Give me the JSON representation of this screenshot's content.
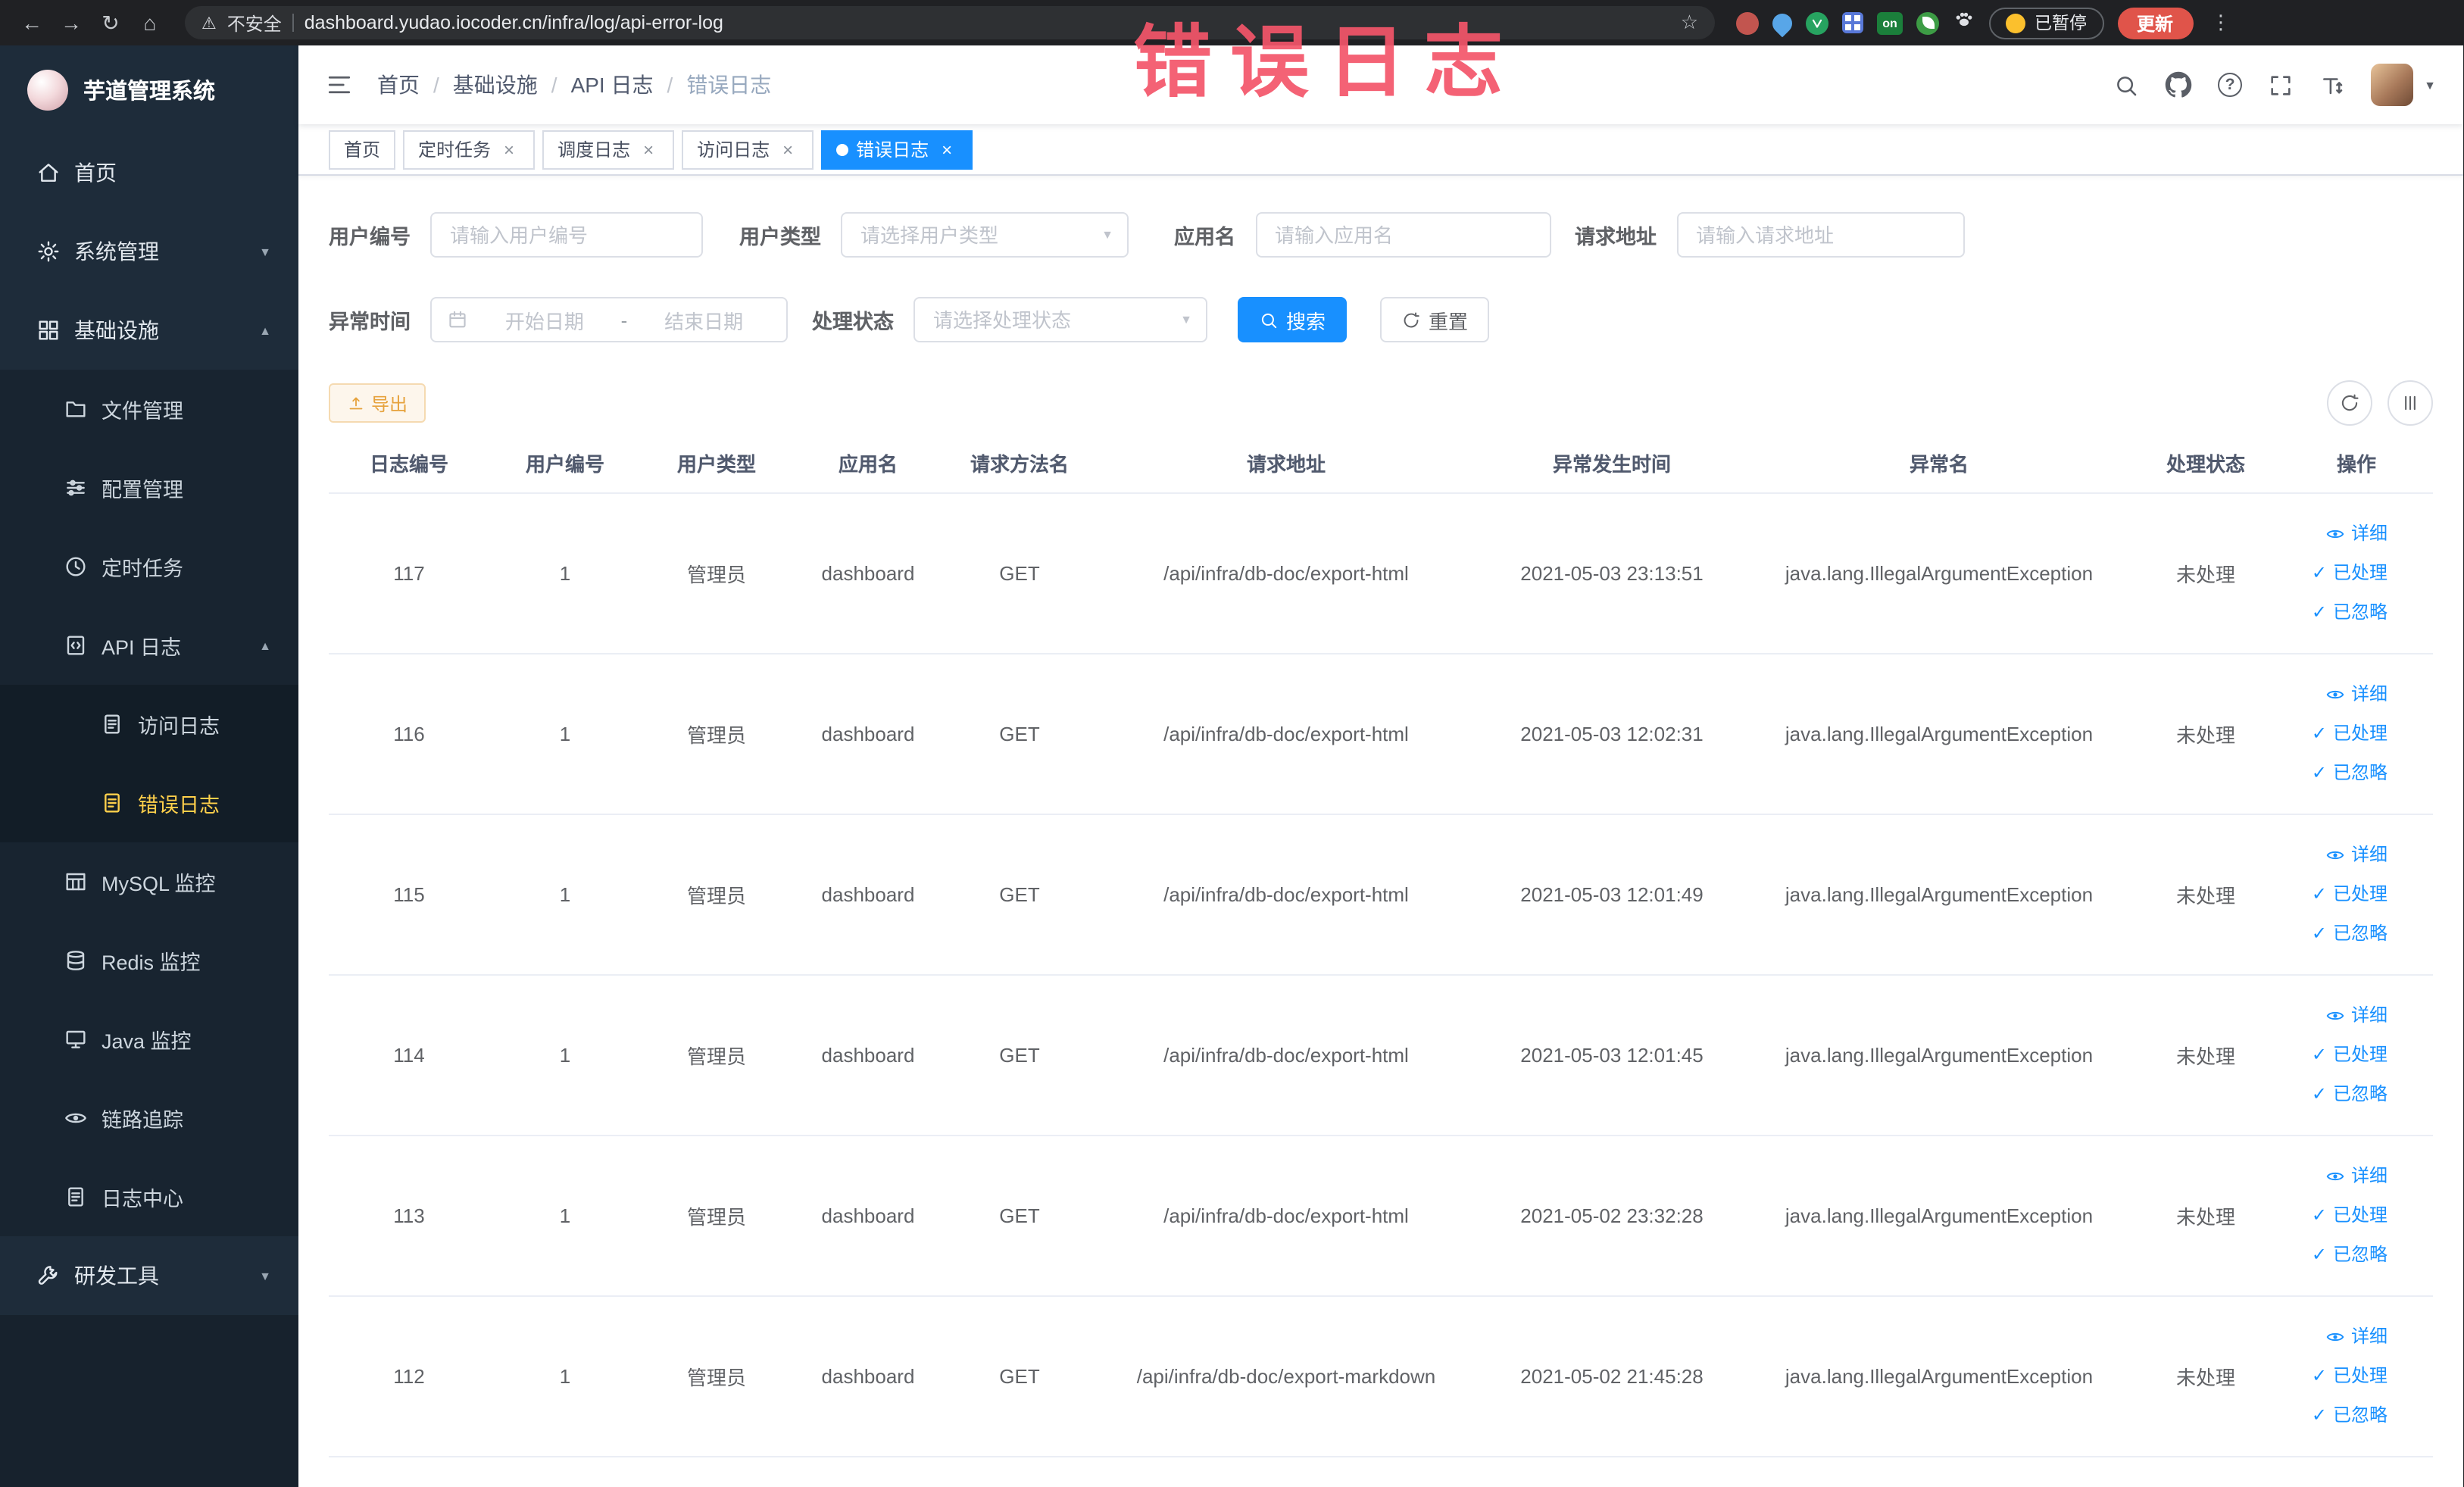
{
  "browser": {
    "security_label": "不安全",
    "url": "dashboard.yudao.iocoder.cn/infra/log/api-error-log",
    "extension_on_badge": "on",
    "paused_badge": "已暂停",
    "update_button": "更新"
  },
  "watermark": "错误日志",
  "sidebar": {
    "logo_title": "芋道管理系统",
    "items": [
      {
        "label": "首页",
        "icon": "home-icon"
      },
      {
        "label": "系统管理",
        "icon": "gear-icon"
      },
      {
        "label": "基础设施",
        "icon": "grid-icon"
      },
      {
        "label": "文件管理",
        "icon": "folder-icon"
      },
      {
        "label": "配置管理",
        "icon": "sliders-icon"
      },
      {
        "label": "定时任务",
        "icon": "clock-icon"
      },
      {
        "label": "API 日志",
        "icon": "api-doc-icon"
      },
      {
        "label": "访问日志",
        "icon": "doc-icon"
      },
      {
        "label": "错误日志",
        "icon": "doc-icon"
      },
      {
        "label": "MySQL 监控",
        "icon": "table-icon"
      },
      {
        "label": "Redis 监控",
        "icon": "database-icon"
      },
      {
        "label": "Java 监控",
        "icon": "monitor-icon"
      },
      {
        "label": "链路追踪",
        "icon": "eye-icon"
      },
      {
        "label": "日志中心",
        "icon": "doc-icon"
      },
      {
        "label": "研发工具",
        "icon": "wrench-icon"
      }
    ]
  },
  "header": {
    "breadcrumb": [
      "首页",
      "基础设施",
      "API 日志",
      "错误日志"
    ],
    "breadcrumb_separator": "/"
  },
  "tabs": [
    {
      "label": "首页"
    },
    {
      "label": "定时任务"
    },
    {
      "label": "调度日志"
    },
    {
      "label": "访问日志"
    },
    {
      "label": "错误日志"
    }
  ],
  "filters": {
    "user_id": {
      "label": "用户编号",
      "placeholder": "请输入用户编号",
      "value": ""
    },
    "user_type": {
      "label": "用户类型",
      "placeholder": "请选择用户类型",
      "value": ""
    },
    "app_name": {
      "label": "应用名",
      "placeholder": "请输入应用名",
      "value": ""
    },
    "request_url": {
      "label": "请求地址",
      "placeholder": "请输入请求地址",
      "value": ""
    },
    "exception_time": {
      "label": "异常时间",
      "start_placeholder": "开始日期",
      "separator": "-",
      "end_placeholder": "结束日期"
    },
    "process_status": {
      "label": "处理状态",
      "placeholder": "请选择处理状态",
      "value": ""
    },
    "search_label": "搜索",
    "reset_label": "重置"
  },
  "toolbar": {
    "export_label": "导出"
  },
  "table": {
    "columns": [
      "日志编号",
      "用户编号",
      "用户类型",
      "应用名",
      "请求方法名",
      "请求地址",
      "异常发生时间",
      "异常名",
      "处理状态",
      "操作"
    ],
    "row_actions": {
      "detail": "详细",
      "processed": "已处理",
      "ignored": "已忽略"
    },
    "rows": [
      {
        "id": "117",
        "user_id": "1",
        "user_type": "管理员",
        "app": "dashboard",
        "method": "GET",
        "url": "/api/infra/db-doc/export-html",
        "time": "2021-05-03 23:13:51",
        "exception": "java.lang.IllegalArgumentException",
        "status": "未处理"
      },
      {
        "id": "116",
        "user_id": "1",
        "user_type": "管理员",
        "app": "dashboard",
        "method": "GET",
        "url": "/api/infra/db-doc/export-html",
        "time": "2021-05-03 12:02:31",
        "exception": "java.lang.IllegalArgumentException",
        "status": "未处理"
      },
      {
        "id": "115",
        "user_id": "1",
        "user_type": "管理员",
        "app": "dashboard",
        "method": "GET",
        "url": "/api/infra/db-doc/export-html",
        "time": "2021-05-03 12:01:49",
        "exception": "java.lang.IllegalArgumentException",
        "status": "未处理"
      },
      {
        "id": "114",
        "user_id": "1",
        "user_type": "管理员",
        "app": "dashboard",
        "method": "GET",
        "url": "/api/infra/db-doc/export-html",
        "time": "2021-05-03 12:01:45",
        "exception": "java.lang.IllegalArgumentException",
        "status": "未处理"
      },
      {
        "id": "113",
        "user_id": "1",
        "user_type": "管理员",
        "app": "dashboard",
        "method": "GET",
        "url": "/api/infra/db-doc/export-html",
        "time": "2021-05-02 23:32:28",
        "exception": "java.lang.IllegalArgumentException",
        "status": "未处理"
      },
      {
        "id": "112",
        "user_id": "1",
        "user_type": "管理员",
        "app": "dashboard",
        "method": "GET",
        "url": "/api/infra/db-doc/export-markdown",
        "time": "2021-05-02 21:45:28",
        "exception": "java.lang.IllegalArgumentException",
        "status": "未处理"
      }
    ]
  },
  "colors": {
    "primary": "#1890ff",
    "sidebar_bg": "#1e2c3a",
    "sidebar_active_text": "#ffd04b",
    "export_warning": "#e6a23c",
    "watermark_pink": "#f4556a",
    "table_border": "#ebeef5"
  }
}
